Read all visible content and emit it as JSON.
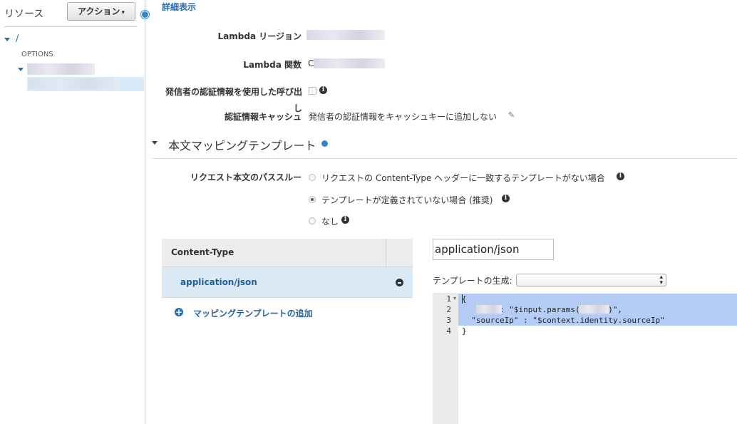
{
  "sidebar": {
    "title": "リソース",
    "action_button": "アクション",
    "action_caret": "▾",
    "root_path": "/",
    "options_method": "OPTIONS"
  },
  "main": {
    "detail_link": "詳細表示",
    "lambda_region_label": "Lambda リージョン",
    "lambda_function_label": "Lambda 関数",
    "lambda_function_value_prefix": "C",
    "caller_cred_label_line1": "発信者の認証情報を使用した呼び出",
    "caller_cred_label_line2": "し",
    "cache_label": "認証情報キャッシュ",
    "cache_value": "発信者の認証情報をキャッシュキーに追加しない",
    "mapping_section_title": "本文マッピングテンプレート",
    "passthrough_label": "リクエスト本文のパススルー",
    "passthrough_options": [
      {
        "label": "リクエストの Content-Type ヘッダーに一致するテンプレートがない場合",
        "checked": false
      },
      {
        "label": "テンプレートが定義されていない場合 (推奨)",
        "checked": true
      },
      {
        "label": "なし",
        "checked": false
      }
    ]
  },
  "content_types": {
    "header": "Content-Type",
    "rows": [
      "application/json"
    ],
    "add_label": "マッピングテンプレートの追加"
  },
  "editor": {
    "content_type_value": "application/json",
    "generate_label": "テンプレートの生成:",
    "generate_value": "",
    "line_numbers": [
      "1",
      "2",
      "3",
      "4"
    ],
    "lines": [
      "{",
      "       \": \"$input.params(      )\",",
      "  \"sourceIp\" : \"$context.identity.sourceIp\"",
      "}"
    ]
  },
  "colors": {
    "link": "#1f6fb5",
    "accent_dot": "#2e88c9",
    "selected_row": "#dceaf6",
    "code_highlight": "#b5cdf5"
  }
}
